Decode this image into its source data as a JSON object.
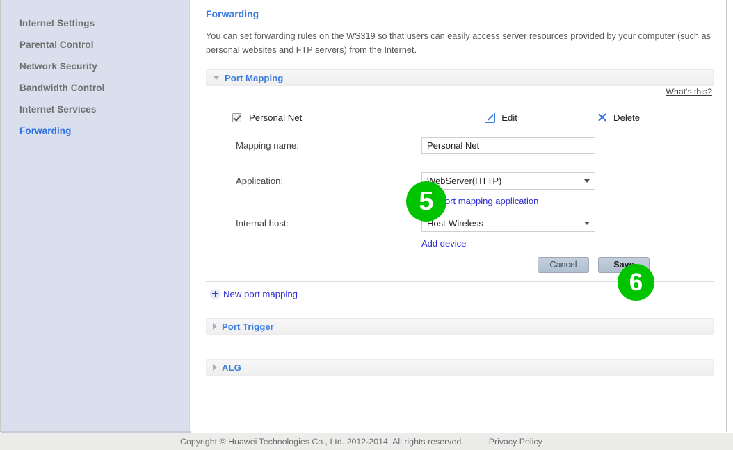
{
  "sidebar": {
    "items": [
      {
        "label": "Internet Settings",
        "active": false
      },
      {
        "label": "Parental Control",
        "active": false
      },
      {
        "label": "Network Security",
        "active": false
      },
      {
        "label": "Bandwidth Control",
        "active": false
      },
      {
        "label": "Internet Services",
        "active": false
      },
      {
        "label": "Forwarding",
        "active": true
      }
    ]
  },
  "content": {
    "title": "Forwarding",
    "description": "You can set forwarding rules on the WS319 so that users can easily access server resources provided by your computer (such as personal websites and FTP servers) from the Internet.",
    "whats_this": "What's this?",
    "sections": [
      {
        "title": "Port Mapping",
        "expanded": true,
        "icon": "chevron-down-icon"
      },
      {
        "title": "Port Trigger",
        "expanded": false,
        "icon": "chevron-right-icon"
      },
      {
        "title": "ALG",
        "expanded": false,
        "icon": "chevron-right-icon"
      }
    ],
    "rule": {
      "checked": true,
      "name": "Personal Net",
      "edit_label": "Edit",
      "edit_icon": "pencil-square-icon",
      "delete_label": "Delete",
      "delete_icon": "close-x-icon"
    },
    "form": {
      "mapping_name": {
        "label": "Mapping name:",
        "value": "Personal Net",
        "placeholder": ""
      },
      "application": {
        "label": "Application:",
        "value": "WebServer(HTTP)",
        "options": [
          "WebServer(HTTP)"
        ],
        "add_link": "Add port mapping application"
      },
      "internal_host": {
        "label": "Internal host:",
        "value": "Host-Wireless",
        "options": [
          "Host-Wireless"
        ],
        "add_link": "Add device"
      }
    },
    "buttons": {
      "cancel": "Cancel",
      "save": "Save"
    },
    "new_mapping": {
      "label": "New port mapping",
      "icon": "plus-circle-icon"
    }
  },
  "footer": {
    "copyright": "Copyright © Huawei Technologies Co., Ltd. 2012-2014. All rights reserved.",
    "privacy": "Privacy Policy"
  },
  "annotations": {
    "badges": [
      {
        "number": "5",
        "color": "#00c400"
      },
      {
        "number": "6",
        "color": "#00c400"
      }
    ]
  }
}
